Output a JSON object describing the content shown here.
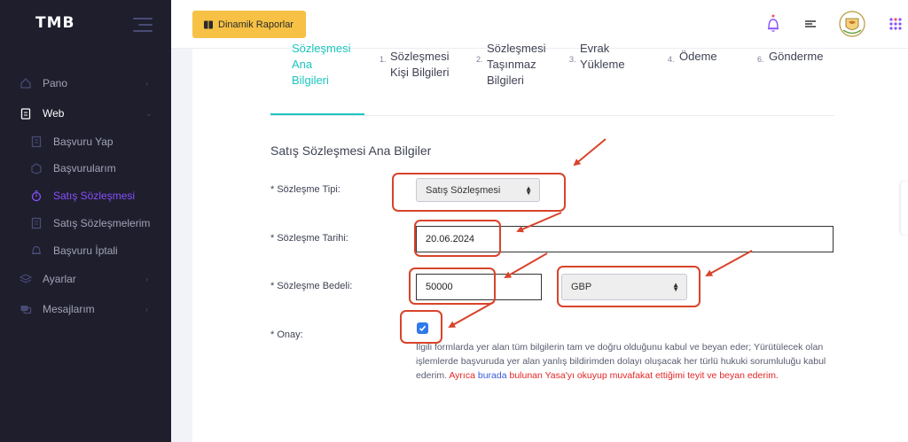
{
  "app": {
    "logo": "TMB"
  },
  "sidebar": {
    "items": [
      {
        "label": "Pano",
        "icon": "home-icon"
      },
      {
        "label": "Web",
        "icon": "clipboard-icon"
      },
      {
        "label": "Başvuru Yap",
        "icon": "document-icon"
      },
      {
        "label": "Başvurularım",
        "icon": "box-icon"
      },
      {
        "label": "Satış Sözleşmesi",
        "icon": "stopwatch-icon"
      },
      {
        "label": "Satış Sözleşmelerim",
        "icon": "document-icon"
      },
      {
        "label": "Başvuru İptali",
        "icon": "bell-icon"
      },
      {
        "label": "Ayarlar",
        "icon": "layers-icon"
      },
      {
        "label": "Mesajlarım",
        "icon": "chat-icon"
      }
    ]
  },
  "topbar": {
    "reports_button": "Dinamik Raporlar"
  },
  "wizard": {
    "steps": [
      {
        "num": "",
        "lines": [
          "Sözleşmesi",
          "Ana",
          "Bilgileri"
        ]
      },
      {
        "num": "1.",
        "lines": [
          "Sözleşmesi",
          "Kişi Bilgileri"
        ]
      },
      {
        "num": "2.",
        "lines": [
          "Sözleşmesi",
          "Taşınmaz",
          "Bilgileri"
        ]
      },
      {
        "num": "3.",
        "lines": [
          "Evrak",
          "Yükleme"
        ]
      },
      {
        "num": "4.",
        "lines": [
          "Ödeme"
        ]
      },
      {
        "num": "6.",
        "lines": [
          "Gönderme"
        ]
      }
    ]
  },
  "form": {
    "title": "Satış Sözleşmesi Ana Bilgiler",
    "contract_type_label": "* Sözleşme Tipi:",
    "contract_type_value": "Satış Sözleşmesi",
    "contract_date_label": "* Sözleşme Tarihi:",
    "contract_date_value": "20.06.2024",
    "contract_amount_label": "* Sözleşme Bedeli:",
    "contract_amount_value": "50000",
    "currency_value": "GBP",
    "approval_label": "* Onay:",
    "approval_checked": true,
    "consent_text_1": "İlgili formlarda yer alan tüm bilgilerin tam ve doğru olduğunu kabul ve beyan eder; Yürütülecek olan işlemlerde başvuruda yer alan yanlış bildirimden dolayı oluşacak her türlü hukuki sorumluluğu kabul ederim.",
    "consent_text_red_1": "Ayrıca",
    "consent_link": "burada",
    "consent_text_red_2": "bulunan Yasa'yı okuyup muvafakat ettiğimi teyit ve beyan ederim."
  },
  "colors": {
    "accent_green": "#1bc5bd",
    "accent_purple": "#8950fc",
    "highlight_red": "#d8442b",
    "button_yellow": "#f6c144"
  }
}
